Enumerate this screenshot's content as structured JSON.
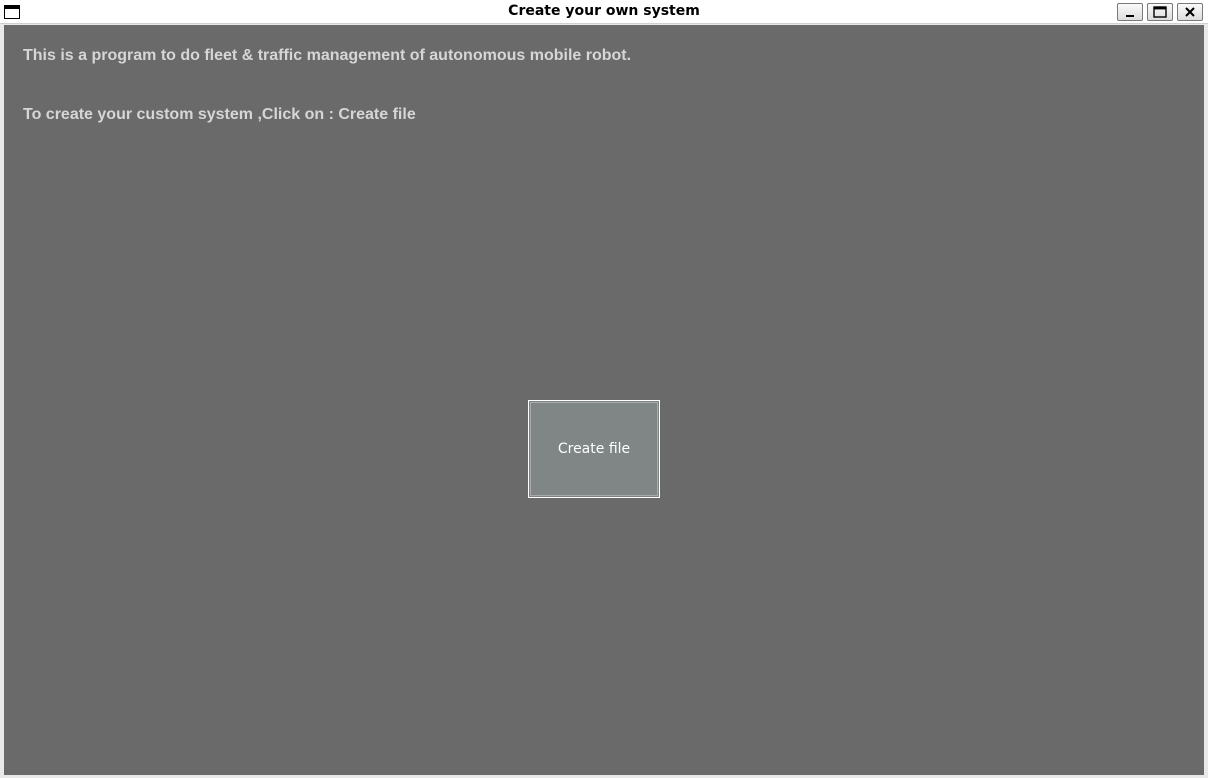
{
  "window": {
    "title": "Create your own system",
    "icon": "window-icon",
    "controls": {
      "minimize_icon": "minimize-icon",
      "maximize_icon": "maximize-icon",
      "close_icon": "close-icon"
    }
  },
  "content": {
    "background_color": "#6a6a6a",
    "text_color": "#d6d6d6",
    "description": "This is a program to do fleet & traffic management of autonomous mobile robot.",
    "instruction": "To create your custom system ,Click on : Create file"
  },
  "create_button": {
    "label": "Create file",
    "color": "#7f8685"
  }
}
